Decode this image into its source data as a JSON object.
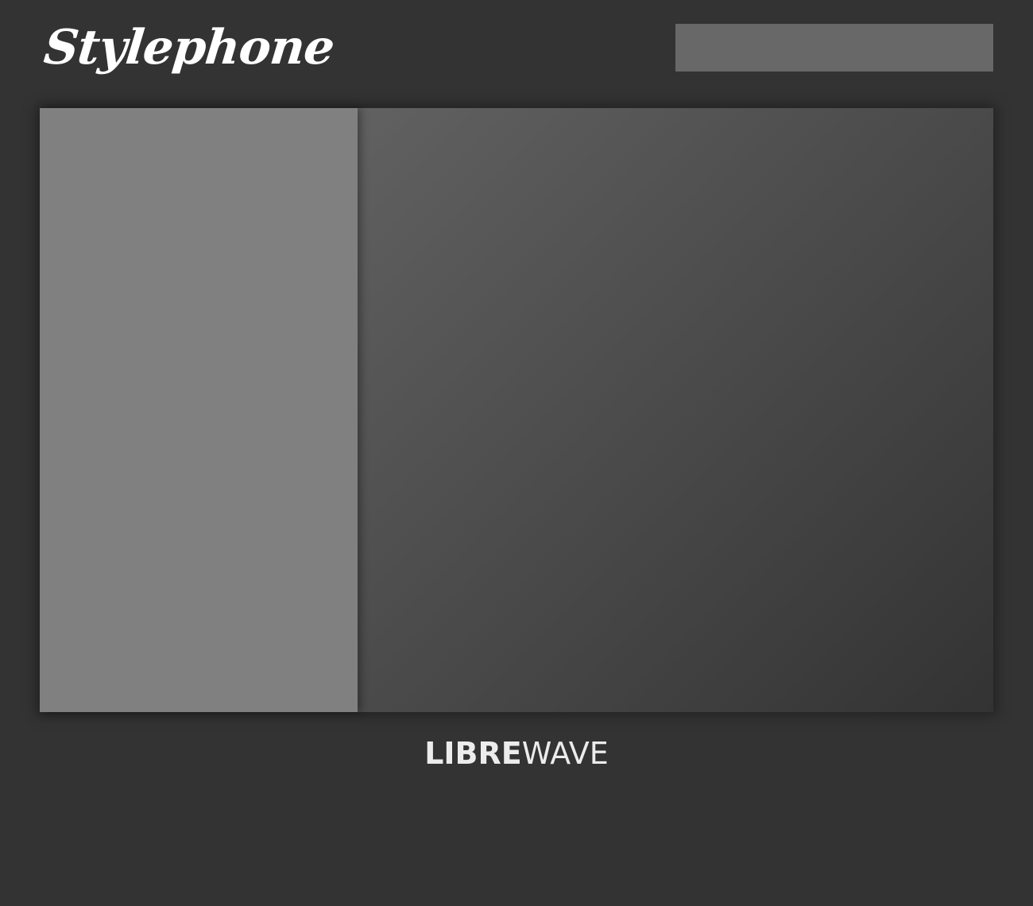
{
  "header": {
    "app_title": "Stylephone",
    "search": {
      "value": "",
      "placeholder": ""
    }
  },
  "main": {
    "left_pane": {},
    "right_pane": {}
  },
  "footer": {
    "logo_bold": "LIBRE",
    "logo_light": "WAVE"
  },
  "colors": {
    "background": "#333333",
    "search_field": "#686868",
    "left_pane": "#808080",
    "right_pane_start": "#616161",
    "right_pane_end": "#333333",
    "text": "#ffffff"
  }
}
